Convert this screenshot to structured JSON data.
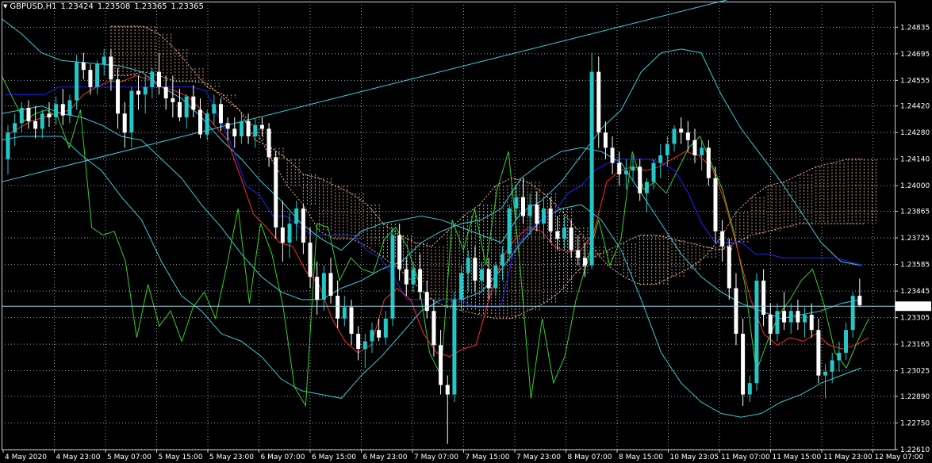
{
  "header": {
    "symbol": "GBPUSD,H1",
    "open": "1.23424",
    "high": "1.23508",
    "low": "1.23365",
    "close": "1.23365"
  },
  "current_price_label": "1.23365",
  "colors": {
    "background": "#000000",
    "grid": "#9aa0a6",
    "frame": "#d0d0d0",
    "bull_candle": "#26c6c6",
    "bear_candle": "#ffffff",
    "tenkan": "#ff2a2a",
    "kijun": "#2222ff",
    "chikou": "#34d226",
    "bollinger": "#3cc8d8",
    "kumo": "#f0b48c",
    "trendline": "#40d0e0",
    "bid_line": "#9ad8e8"
  },
  "chart_data": {
    "type": "candlestick",
    "title": "GBPUSD,H1",
    "ylim": [
      1.2261,
      1.2497
    ],
    "price_ticks": [
      "1.24835",
      "1.24695",
      "1.24555",
      "1.24420",
      "1.24280",
      "1.24140",
      "1.24000",
      "1.23865",
      "1.23725",
      "1.23585",
      "1.23445",
      "1.23305",
      "1.23165",
      "1.23025",
      "1.22890",
      "1.22750",
      "1.22610"
    ],
    "time_ticks": [
      "4 May 2020",
      "4 May 23:00",
      "5 May 07:00",
      "5 May 15:00",
      "5 May 23:00",
      "6 May 07:00",
      "6 May 15:00",
      "6 May 23:00",
      "7 May 07:00",
      "7 May 15:00",
      "7 May 23:00",
      "8 May 07:00",
      "8 May 15:00",
      "10 May 23:05",
      "11 May 07:00",
      "11 May 15:00",
      "11 May 23:00",
      "12 May 07:00"
    ],
    "current_price": 1.23365,
    "candles_ohlc": [
      [
        1.2414,
        1.2432,
        1.2406,
        1.2428
      ],
      [
        1.2428,
        1.2438,
        1.2421,
        1.2433
      ],
      [
        1.2433,
        1.2444,
        1.2428,
        1.2441
      ],
      [
        1.2441,
        1.2445,
        1.243,
        1.2434
      ],
      [
        1.2434,
        1.2442,
        1.2425,
        1.243
      ],
      [
        1.243,
        1.244,
        1.2425,
        1.2438
      ],
      [
        1.2438,
        1.2444,
        1.2431,
        1.2436
      ],
      [
        1.2436,
        1.2447,
        1.2432,
        1.2443
      ],
      [
        1.2443,
        1.2451,
        1.2432,
        1.2437
      ],
      [
        1.2437,
        1.2448,
        1.2433,
        1.2445
      ],
      [
        1.2445,
        1.2469,
        1.244,
        1.2465
      ],
      [
        1.2465,
        1.247,
        1.2456,
        1.2461
      ],
      [
        1.2461,
        1.2464,
        1.2448,
        1.2452
      ],
      [
        1.2452,
        1.2466,
        1.2448,
        1.2464
      ],
      [
        1.2464,
        1.2472,
        1.2458,
        1.2468
      ],
      [
        1.2468,
        1.2472,
        1.245,
        1.2456
      ],
      [
        1.2456,
        1.2462,
        1.243,
        1.2438
      ],
      [
        1.2438,
        1.2444,
        1.242,
        1.2428
      ],
      [
        1.2428,
        1.2452,
        1.242,
        1.245
      ],
      [
        1.245,
        1.2458,
        1.244,
        1.2448
      ],
      [
        1.2448,
        1.2458,
        1.2438,
        1.2452
      ],
      [
        1.2452,
        1.2462,
        1.2446,
        1.246
      ],
      [
        1.246,
        1.247,
        1.2448,
        1.2452
      ],
      [
        1.2452,
        1.2458,
        1.244,
        1.2446
      ],
      [
        1.2446,
        1.2458,
        1.2436,
        1.2444
      ],
      [
        1.2444,
        1.2451,
        1.2434,
        1.2436
      ],
      [
        1.2436,
        1.2448,
        1.243,
        1.2447
      ],
      [
        1.2447,
        1.2453,
        1.2436,
        1.244
      ],
      [
        1.244,
        1.2446,
        1.2425,
        1.2427
      ],
      [
        1.2427,
        1.244,
        1.2424,
        1.2438
      ],
      [
        1.2438,
        1.2448,
        1.2432,
        1.2443
      ],
      [
        1.2443,
        1.2446,
        1.2429,
        1.2433
      ],
      [
        1.2433,
        1.2436,
        1.2424,
        1.243
      ],
      [
        1.243,
        1.2436,
        1.242,
        1.2426
      ],
      [
        1.2426,
        1.2438,
        1.2422,
        1.2434
      ],
      [
        1.2434,
        1.2438,
        1.2422,
        1.2426
      ],
      [
        1.2426,
        1.2435,
        1.242,
        1.2432
      ],
      [
        1.2432,
        1.2436,
        1.2426,
        1.243
      ],
      [
        1.243,
        1.2433,
        1.241,
        1.2415
      ],
      [
        1.2415,
        1.2418,
        1.2372,
        1.2378
      ],
      [
        1.2378,
        1.2392,
        1.236,
        1.237
      ],
      [
        1.237,
        1.2386,
        1.2362,
        1.238
      ],
      [
        1.238,
        1.2392,
        1.2371,
        1.2388
      ],
      [
        1.2388,
        1.239,
        1.2364,
        1.237
      ],
      [
        1.237,
        1.2378,
        1.2346,
        1.2352
      ],
      [
        1.2352,
        1.236,
        1.2332,
        1.234
      ],
      [
        1.234,
        1.2358,
        1.2334,
        1.2354
      ],
      [
        1.2354,
        1.2362,
        1.2338,
        1.2342
      ],
      [
        1.2342,
        1.235,
        1.2325,
        1.233
      ],
      [
        1.233,
        1.2342,
        1.2326,
        1.2336
      ],
      [
        1.2336,
        1.234,
        1.2316,
        1.2322
      ],
      [
        1.2322,
        1.2326,
        1.2308,
        1.2314
      ],
      [
        1.2314,
        1.2322,
        1.2304,
        1.2318
      ],
      [
        1.2318,
        1.2328,
        1.2312,
        1.2324
      ],
      [
        1.2324,
        1.233,
        1.2318,
        1.232
      ],
      [
        1.232,
        1.2334,
        1.2316,
        1.233
      ],
      [
        1.233,
        1.2378,
        1.2326,
        1.2374
      ],
      [
        1.2374,
        1.238,
        1.235,
        1.2356
      ],
      [
        1.2356,
        1.2362,
        1.2342,
        1.2348
      ],
      [
        1.2348,
        1.236,
        1.2344,
        1.2356
      ],
      [
        1.2356,
        1.2364,
        1.234,
        1.2344
      ],
      [
        1.2344,
        1.235,
        1.233,
        1.2334
      ],
      [
        1.2334,
        1.234,
        1.231,
        1.2316
      ],
      [
        1.2316,
        1.2324,
        1.229,
        1.2295
      ],
      [
        1.2295,
        1.23,
        1.2264,
        1.229
      ],
      [
        1.229,
        1.2344,
        1.2286,
        1.234
      ],
      [
        1.234,
        1.2358,
        1.2334,
        1.2354
      ],
      [
        1.2354,
        1.2366,
        1.2344,
        1.2362
      ],
      [
        1.2362,
        1.2368,
        1.2344,
        1.235
      ],
      [
        1.235,
        1.236,
        1.2345,
        1.2356
      ],
      [
        1.2356,
        1.2362,
        1.234,
        1.2346
      ],
      [
        1.2346,
        1.236,
        1.2342,
        1.2358
      ],
      [
        1.2358,
        1.2368,
        1.235,
        1.2364
      ],
      [
        1.2364,
        1.239,
        1.236,
        1.2388
      ],
      [
        1.2388,
        1.24,
        1.2382,
        1.2394
      ],
      [
        1.2394,
        1.2404,
        1.238,
        1.2384
      ],
      [
        1.2384,
        1.2396,
        1.2374,
        1.239
      ],
      [
        1.239,
        1.2397,
        1.2376,
        1.238
      ],
      [
        1.238,
        1.2392,
        1.2372,
        1.2388
      ],
      [
        1.2388,
        1.2394,
        1.237,
        1.2376
      ],
      [
        1.2376,
        1.2384,
        1.2366,
        1.2372
      ],
      [
        1.2372,
        1.2384,
        1.2366,
        1.2378
      ],
      [
        1.2378,
        1.2382,
        1.2362,
        1.2366
      ],
      [
        1.2366,
        1.2374,
        1.2358,
        1.2362
      ],
      [
        1.2362,
        1.237,
        1.2352,
        1.2358
      ],
      [
        1.2358,
        1.247,
        1.2356,
        1.246
      ],
      [
        1.246,
        1.2468,
        1.242,
        1.2428
      ],
      [
        1.2428,
        1.2434,
        1.2414,
        1.242
      ],
      [
        1.242,
        1.2426,
        1.2406,
        1.2412
      ],
      [
        1.2412,
        1.2418,
        1.24,
        1.2406
      ],
      [
        1.2406,
        1.2414,
        1.2398,
        1.2408
      ],
      [
        1.2408,
        1.2416,
        1.2402,
        1.241
      ],
      [
        1.241,
        1.2414,
        1.2392,
        1.2396
      ],
      [
        1.2396,
        1.2404,
        1.2386,
        1.2402
      ],
      [
        1.2402,
        1.2414,
        1.2398,
        1.2412
      ],
      [
        1.2412,
        1.2422,
        1.2404,
        1.2416
      ],
      [
        1.2416,
        1.2426,
        1.241,
        1.2422
      ],
      [
        1.2422,
        1.2432,
        1.2418,
        1.243
      ],
      [
        1.243,
        1.2436,
        1.2422,
        1.2428
      ],
      [
        1.2428,
        1.2434,
        1.2418,
        1.2424
      ],
      [
        1.2424,
        1.243,
        1.2412,
        1.2416
      ],
      [
        1.2416,
        1.2424,
        1.2408,
        1.242
      ],
      [
        1.242,
        1.2424,
        1.24,
        1.2404
      ],
      [
        1.2404,
        1.241,
        1.237,
        1.2376
      ],
      [
        1.2376,
        1.2382,
        1.236,
        1.2368
      ],
      [
        1.2368,
        1.2372,
        1.234,
        1.2346
      ],
      [
        1.2346,
        1.2354,
        1.2316,
        1.2322
      ],
      [
        1.2322,
        1.233,
        1.2284,
        1.229
      ],
      [
        1.229,
        1.23,
        1.2286,
        1.2296
      ],
      [
        1.2296,
        1.2354,
        1.2292,
        1.235
      ],
      [
        1.235,
        1.2356,
        1.2326,
        1.2332
      ],
      [
        1.2332,
        1.2338,
        1.2316,
        1.2322
      ],
      [
        1.2322,
        1.2338,
        1.2318,
        1.2334
      ],
      [
        1.2334,
        1.2344,
        1.2324,
        1.2328
      ],
      [
        1.2328,
        1.2338,
        1.2322,
        1.2334
      ],
      [
        1.2334,
        1.234,
        1.2324,
        1.2328
      ],
      [
        1.2328,
        1.2336,
        1.232,
        1.2332
      ],
      [
        1.2332,
        1.2338,
        1.232,
        1.2324
      ],
      [
        1.2324,
        1.233,
        1.2296,
        1.23
      ],
      [
        1.23,
        1.2306,
        1.2288,
        1.2302
      ],
      [
        1.2302,
        1.2312,
        1.2296,
        1.2308
      ],
      [
        1.2308,
        1.2318,
        1.2302,
        1.2312
      ],
      [
        1.2312,
        1.2328,
        1.2308,
        1.2324
      ],
      [
        1.2324,
        1.2344,
        1.232,
        1.2342
      ],
      [
        1.2342,
        1.2351,
        1.2336,
        1.2337
      ]
    ],
    "tenkan_sen": [
      1.2426,
      1.243,
      1.2434,
      1.2436,
      1.2438,
      1.244,
      1.2448,
      1.2452,
      1.2455,
      1.2455,
      1.2458,
      1.2456,
      1.2452,
      1.245,
      1.2447,
      1.244,
      1.2432,
      1.2424,
      1.2405,
      1.2385,
      1.2378,
      1.237,
      1.2368,
      1.2355,
      1.2348,
      1.233,
      1.2318,
      1.2312,
      1.2316,
      1.234,
      1.2346,
      1.234,
      1.2322,
      1.2312,
      1.231,
      1.2314,
      1.2316,
      1.234,
      1.2362,
      1.2372,
      1.2378,
      1.2376,
      1.2368,
      1.2365,
      1.2366,
      1.2375,
      1.2402,
      1.2408,
      1.241,
      1.2408,
      1.241,
      1.2414,
      1.2418,
      1.2416,
      1.241,
      1.2392,
      1.2366,
      1.234,
      1.2322,
      1.2316,
      1.232,
      1.2318,
      1.2322,
      1.2316,
      1.2314,
      1.2316,
      1.232
    ],
    "kijun_sen": [
      1.2448,
      1.2448,
      1.2448,
      1.2448,
      1.2452,
      1.2452,
      1.2452,
      1.2452,
      1.2452,
      1.2452,
      1.2452,
      1.2452,
      1.2452,
      1.2452,
      1.2452,
      1.245,
      1.2436,
      1.242,
      1.24,
      1.2395,
      1.2384,
      1.2384,
      1.2378,
      1.2374,
      1.2374,
      1.2374,
      1.2374,
      1.2366,
      1.2362,
      1.2352,
      1.234,
      1.234,
      1.234,
      1.234,
      1.234,
      1.2336,
      1.2336,
      1.2336,
      1.2366,
      1.2376,
      1.2382,
      1.2386,
      1.2396,
      1.24,
      1.2408,
      1.2412,
      1.2414,
      1.2414,
      1.2414,
      1.2412,
      1.2408,
      1.2396,
      1.238,
      1.237,
      1.237,
      1.237,
      1.2364,
      1.2364,
      1.2362,
      1.2362,
      1.2362,
      1.2362,
      1.2362,
      1.236,
      1.2358
    ],
    "chikou_span": [
      1.2458,
      1.2446,
      1.2434,
      1.2438,
      1.244,
      1.2436,
      1.242,
      1.244,
      1.2378,
      1.2374,
      1.2376,
      1.236,
      1.232,
      1.2348,
      1.2326,
      1.2334,
      1.2318,
      1.2336,
      1.2344,
      1.233,
      1.2358,
      1.2388,
      1.2338,
      1.238,
      1.2364,
      1.2336,
      1.2294,
      1.2284,
      1.238,
      1.2378,
      1.235,
      1.2362,
      1.2356,
      1.2354,
      1.2372,
      1.2378,
      1.2368,
      1.235,
      1.2312,
      1.23,
      1.2382,
      1.2366,
      1.2388,
      1.2358,
      1.2398,
      1.2418,
      1.236,
      1.2288,
      1.233,
      1.2296,
      1.231,
      1.234,
      1.236,
      1.2382,
      1.2358,
      1.2372,
      1.2418,
      1.2398,
      1.2402,
      1.2396,
      1.2408,
      1.242,
      1.2426,
      1.2412,
      1.2398,
      1.2376,
      1.2348,
      1.2302,
      1.2318,
      1.2332,
      1.234,
      1.235,
      1.2356,
      1.2338,
      1.2312,
      1.2304,
      1.2318,
      1.233
    ],
    "bollinger_upper": [
      1.2488,
      1.248,
      1.247,
      1.2466,
      1.2465,
      1.2464,
      1.2463,
      1.246,
      1.2452,
      1.2446,
      1.2436,
      1.2424,
      1.2414,
      1.2402,
      1.2392,
      1.238,
      1.2372,
      1.2366,
      1.2376,
      1.238,
      1.2382,
      1.2384,
      1.2382,
      1.2378,
      1.2374,
      1.237,
      1.2386,
      1.2392,
      1.2402,
      1.2416,
      1.243,
      1.244,
      1.246,
      1.247,
      1.2472,
      1.247,
      1.2448,
      1.243,
      1.2416,
      1.2402,
      1.2386,
      1.237,
      1.236,
      1.2358
    ],
    "bollinger_middle": [
      1.2438,
      1.244,
      1.2442,
      1.2438,
      1.2436,
      1.2432,
      1.2426,
      1.2424,
      1.2414,
      1.2404,
      1.239,
      1.2378,
      1.2364,
      1.2352,
      1.2344,
      1.234,
      1.234,
      1.2346,
      1.235,
      1.2356,
      1.236,
      1.237,
      1.2376,
      1.238,
      1.2382,
      1.2388,
      1.2404,
      1.2412,
      1.2418,
      1.242,
      1.2418,
      1.2412,
      1.2396,
      1.238,
      1.2364,
      1.2352,
      1.2344,
      1.2338,
      1.2334,
      1.233,
      1.2332,
      1.2334,
      1.2338,
      1.234
    ],
    "bollinger_lower": [
      1.2424,
      1.2426,
      1.2426,
      1.2426,
      1.2416,
      1.2408,
      1.2394,
      1.2382,
      1.236,
      1.2342,
      1.2334,
      1.2322,
      1.2318,
      1.231,
      1.2298,
      1.2292,
      1.229,
      1.2288,
      1.23,
      1.231,
      1.2322,
      1.2334,
      1.234,
      1.234,
      1.2344,
      1.2356,
      1.237,
      1.2382,
      1.2388,
      1.239,
      1.2382,
      1.2366,
      1.234,
      1.2312,
      1.2296,
      1.2286,
      1.228,
      1.2278,
      1.228,
      1.2286,
      1.229,
      1.2296,
      1.23,
      1.2304
    ],
    "senkou_span_a": [
      1.2484,
      1.2484,
      1.2484,
      1.248,
      1.2472,
      1.2462,
      1.2452,
      1.2448,
      1.244,
      1.2424,
      1.242,
      1.2414,
      1.2406,
      1.2404,
      1.24,
      1.2396,
      1.239,
      1.238,
      1.2374,
      1.237,
      1.2368,
      1.2376,
      1.2384,
      1.239,
      1.24,
      1.2404,
      1.2402,
      1.2396,
      1.2388,
      1.2378,
      1.2368,
      1.2358,
      1.2352,
      1.2348,
      1.2348,
      1.2352,
      1.2356,
      1.2362,
      1.2372,
      1.2386,
      1.2394,
      1.24,
      1.2402,
      1.2406,
      1.241,
      1.2412,
      1.2414,
      1.2414
    ],
    "senkou_span_b": [
      1.2458,
      1.2458,
      1.246,
      1.2458,
      1.2455,
      1.2455,
      1.2454,
      1.2446,
      1.244,
      1.243,
      1.2414,
      1.24,
      1.239,
      1.2376,
      1.2372,
      1.2372,
      1.2368,
      1.2362,
      1.2356,
      1.2348,
      1.234,
      1.2336,
      1.2334,
      1.2332,
      1.233,
      1.233,
      1.2334,
      1.2338,
      1.2344,
      1.2354,
      1.2362,
      1.2366,
      1.237,
      1.2374,
      1.2374,
      1.2372,
      1.237,
      1.2368,
      1.2366,
      1.237,
      1.2374,
      1.2376,
      1.2378,
      1.238,
      1.238,
      1.238,
      1.238,
      1.238
    ],
    "trendline": [
      [
        1.2402,
        1.2503
      ]
    ]
  }
}
